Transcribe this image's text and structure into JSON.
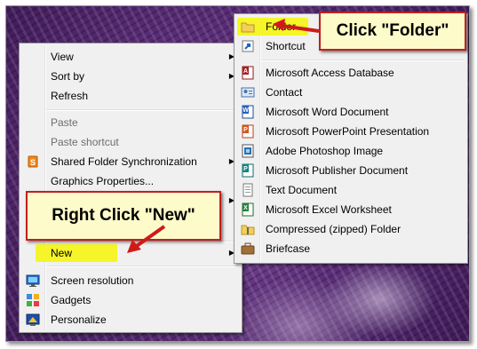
{
  "context_menu": {
    "items": [
      {
        "label": "View",
        "submenu": true
      },
      {
        "label": "Sort by",
        "submenu": true
      },
      {
        "label": "Refresh"
      },
      {
        "label": "Paste",
        "disabled": true
      },
      {
        "label": "Paste shortcut",
        "disabled": true
      },
      {
        "label": "Shared Folder Synchronization",
        "submenu": true,
        "icon": "sync-icon"
      },
      {
        "label": "Graphics Properties..."
      },
      {
        "label": "New",
        "submenu": true,
        "highlighted": true
      },
      {
        "label": "Screen resolution",
        "icon": "screen-resolution-icon"
      },
      {
        "label": "Gadgets",
        "icon": "gadgets-icon"
      },
      {
        "label": "Personalize",
        "icon": "personalize-icon"
      }
    ],
    "arrow_glyph": "▶"
  },
  "new_submenu": {
    "items": [
      {
        "label": "Folder",
        "icon": "folder-icon",
        "highlighted": true
      },
      {
        "label": "Shortcut",
        "icon": "shortcut-icon"
      },
      {
        "label": "Microsoft Access Database",
        "icon": "access-icon"
      },
      {
        "label": "Contact",
        "icon": "contact-icon"
      },
      {
        "label": "Microsoft Word Document",
        "icon": "word-icon"
      },
      {
        "label": "Microsoft PowerPoint Presentation",
        "icon": "powerpoint-icon"
      },
      {
        "label": "Adobe Photoshop Image",
        "icon": "photoshop-icon"
      },
      {
        "label": "Microsoft Publisher Document",
        "icon": "publisher-icon"
      },
      {
        "label": "Text Document",
        "icon": "text-document-icon"
      },
      {
        "label": "Microsoft Excel Worksheet",
        "icon": "excel-icon"
      },
      {
        "label": "Compressed (zipped) Folder",
        "icon": "zip-folder-icon"
      },
      {
        "label": "Briefcase",
        "icon": "briefcase-icon"
      }
    ]
  },
  "annotations": {
    "folder_callout": "Click \"Folder\"",
    "new_callout": "Right Click \"New\""
  },
  "colors": {
    "highlight": "#f5f52a",
    "callout_bg": "#fdfbc9",
    "callout_border": "#c02020",
    "arrow": "#d01a1a",
    "menu_bg": "#f0f0f0"
  }
}
